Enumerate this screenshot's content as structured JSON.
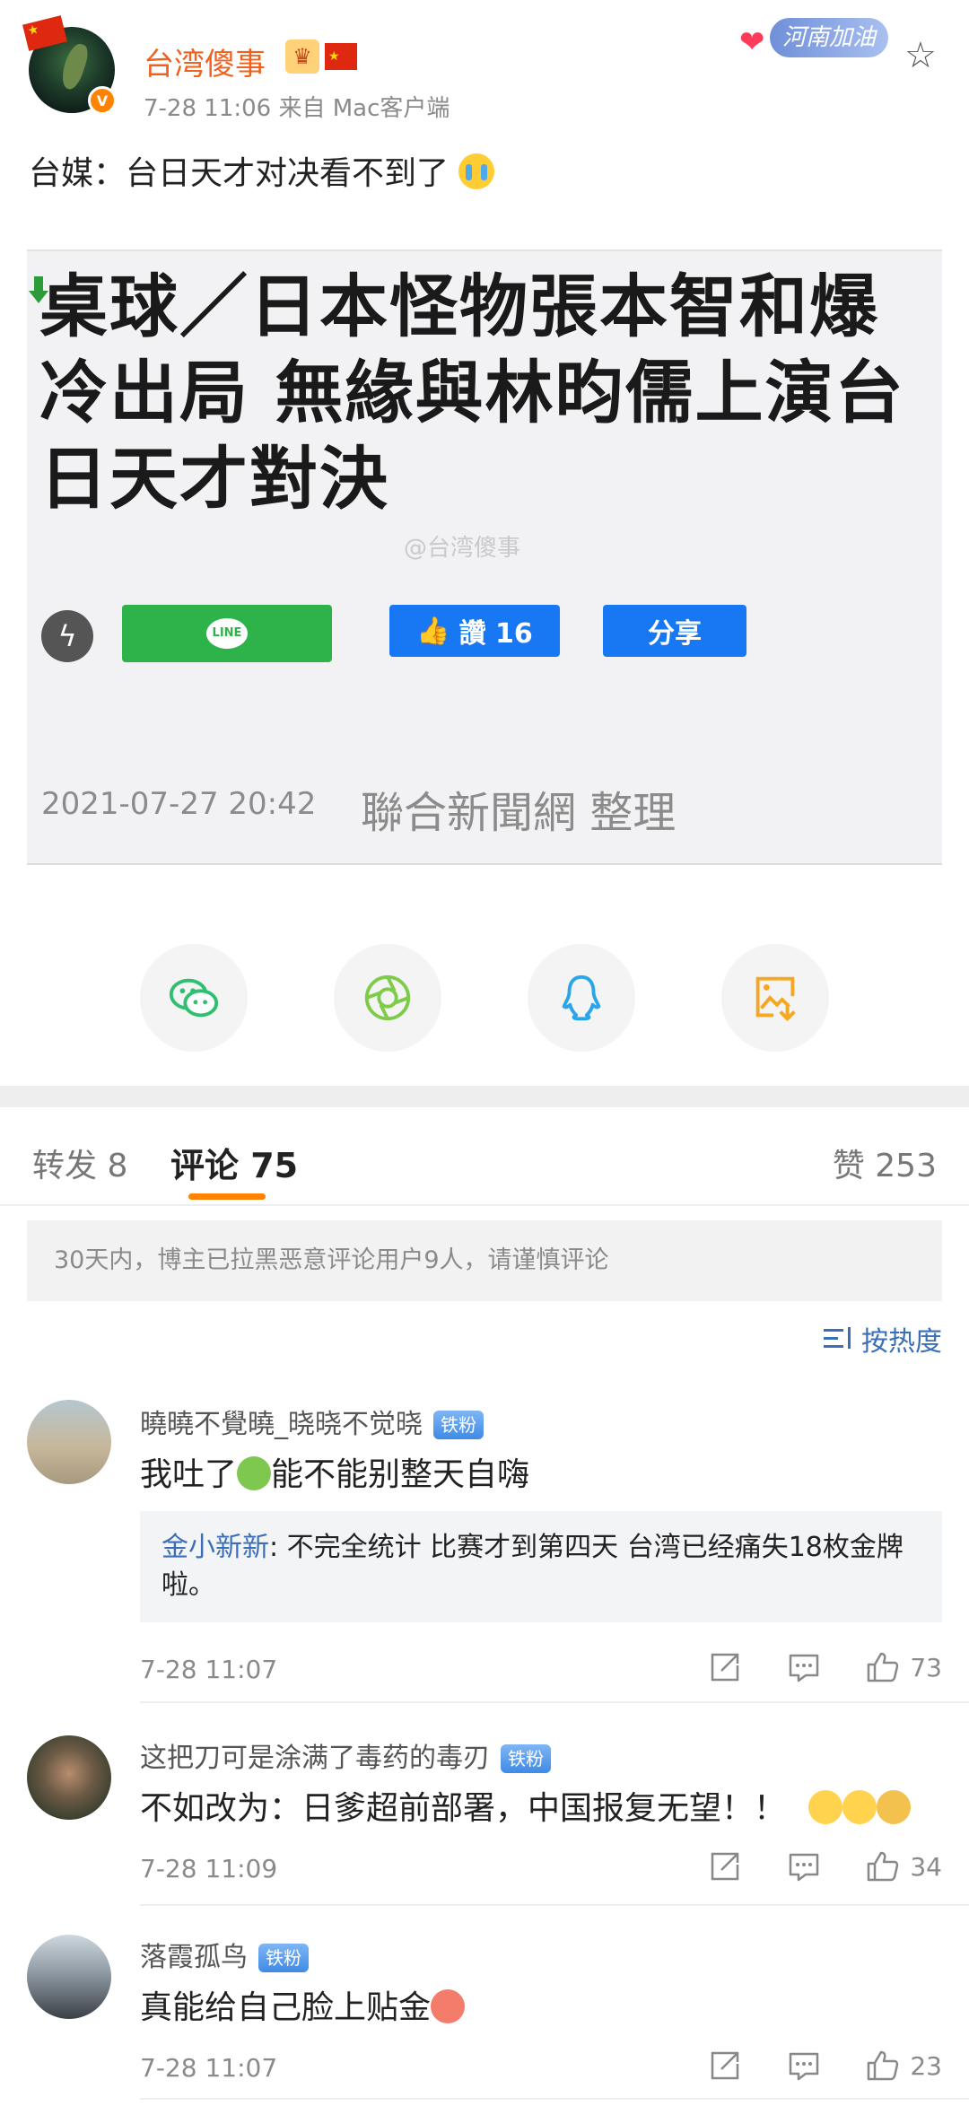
{
  "post": {
    "author": "台湾傻事",
    "verified_mark": "V",
    "meta": "7-28 11:06   来自 Mac客户端",
    "badge_text": "河南加油",
    "text": "台媒：台日天才对决看不到了"
  },
  "news_image": {
    "headline": "桌球／日本怪物張本智和爆冷出局 無緣與林昀儒上演台日天才對決",
    "watermark": "@台湾傻事",
    "line_label": "LINE",
    "like_label": "讚 16",
    "share_label": "分享",
    "date": "2021-07-27 20:42",
    "source": "聯合新聞網 整理"
  },
  "share_targets": [
    {
      "icon": "wechat-icon"
    },
    {
      "icon": "moments-icon"
    },
    {
      "icon": "qq-icon"
    },
    {
      "icon": "save-image-icon"
    }
  ],
  "tabs": {
    "repost": "转发 8",
    "comment": "评论 75",
    "like": "赞 253"
  },
  "notice": "30天内，博主已拉黑恶意评论用户9人，请谨慎评论",
  "sort": {
    "label": "按热度"
  },
  "comments": [
    {
      "user": "曉曉不覺曉_晓晓不觉晓",
      "badge": "铁粉",
      "text_before": "我吐了",
      "text_after": "能不能别整天自嗨",
      "reply_user": "金小新新",
      "reply_text": ": 不完全统计 比赛才到第四天 台湾已经痛失18枚金牌啦。",
      "time": "7-28 11:07",
      "likes": "73"
    },
    {
      "user": "这把刀可是涂满了毒药的毒刃",
      "badge": "铁粉",
      "text": "不如改为：日爹超前部署，中国报复无望！！",
      "time": "7-28 11:09",
      "likes": "34"
    },
    {
      "user": "落霞孤鸟",
      "badge": "铁粉",
      "text": "真能给自己脸上贴金",
      "time": "7-28 11:07",
      "likes": "23"
    }
  ],
  "colors": {
    "accent": "#ff8200",
    "link": "#3a6fb8",
    "author": "#f0611e"
  }
}
